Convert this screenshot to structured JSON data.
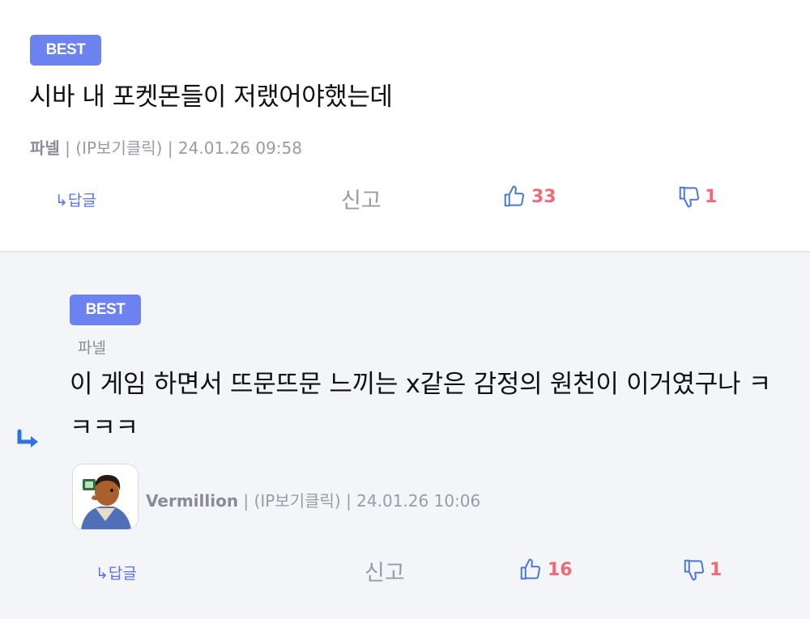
{
  "comments": [
    {
      "badge": "BEST",
      "text": "시바 내 포켓몬들이 저랬어야했는데",
      "author": "파넬",
      "ip": "(IP보기클릭)",
      "date": "24.01.26 09:58",
      "reply_label": "↳답글",
      "report_label": "신고",
      "upvotes": "33",
      "downvotes": "1"
    },
    {
      "badge": "BEST",
      "parent_author": "파넬",
      "text": "이 게임 하면서 뜨문뜨문 느끼는 x같은 감정의 원천이 이거였구나 ㅋㅋㅋㅋ",
      "author": "Vermillion",
      "ip": "(IP보기클릭)",
      "date": "24.01.26 10:06",
      "reply_label": "↳답글",
      "report_label": "신고",
      "upvotes": "16",
      "downvotes": "1"
    }
  ],
  "icons": {
    "thumbs_up": "thumbs-up-icon",
    "thumbs_down": "thumbs-down-icon",
    "reply_arrow": "reply-arrow-icon",
    "avatar": "user-avatar"
  },
  "colors": {
    "badge": "#6c82ef",
    "vote": "#ef6a79",
    "icon_blue": "#4a78d6",
    "reply_bg": "#f4f5f8"
  }
}
